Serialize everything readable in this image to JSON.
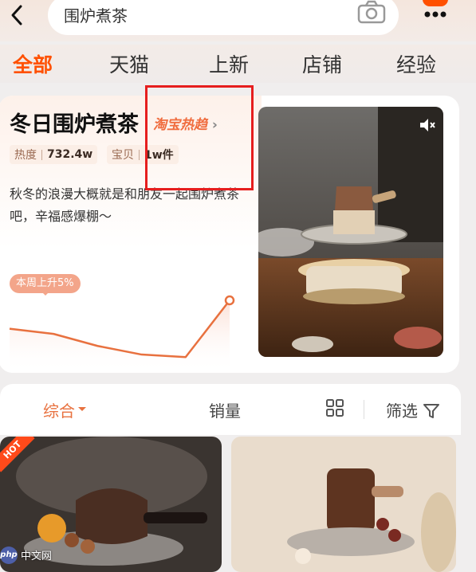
{
  "search": {
    "query": "围炉煮茶"
  },
  "tabs": [
    "全部",
    "天猫",
    "上新",
    "店铺",
    "经验"
  ],
  "trend": {
    "title": "冬日围炉煮茶",
    "link": "淘宝热趋",
    "heat_label": "热度",
    "heat_value": "732.4w",
    "items_label": "宝贝",
    "items_value": "1w件",
    "description": "秋冬的浪漫大概就是和朋友一起围炉煮茶吧，辛福感爆棚～",
    "weekly_badge": "本周上升5%",
    "trend_series": [
      0.42,
      0.36,
      0.22,
      0.12,
      0.09,
      0.75
    ]
  },
  "sort": {
    "comprehensive": "综合",
    "sales": "销量",
    "filter": "筛选"
  },
  "products": [
    {
      "badge": "HOT"
    },
    {}
  ],
  "watermark": {
    "logo": "php",
    "text": "中文网"
  },
  "colors": {
    "accent": "#ff5000",
    "highlight_box": "#e61e1e",
    "trend_line": "#e8713f"
  }
}
